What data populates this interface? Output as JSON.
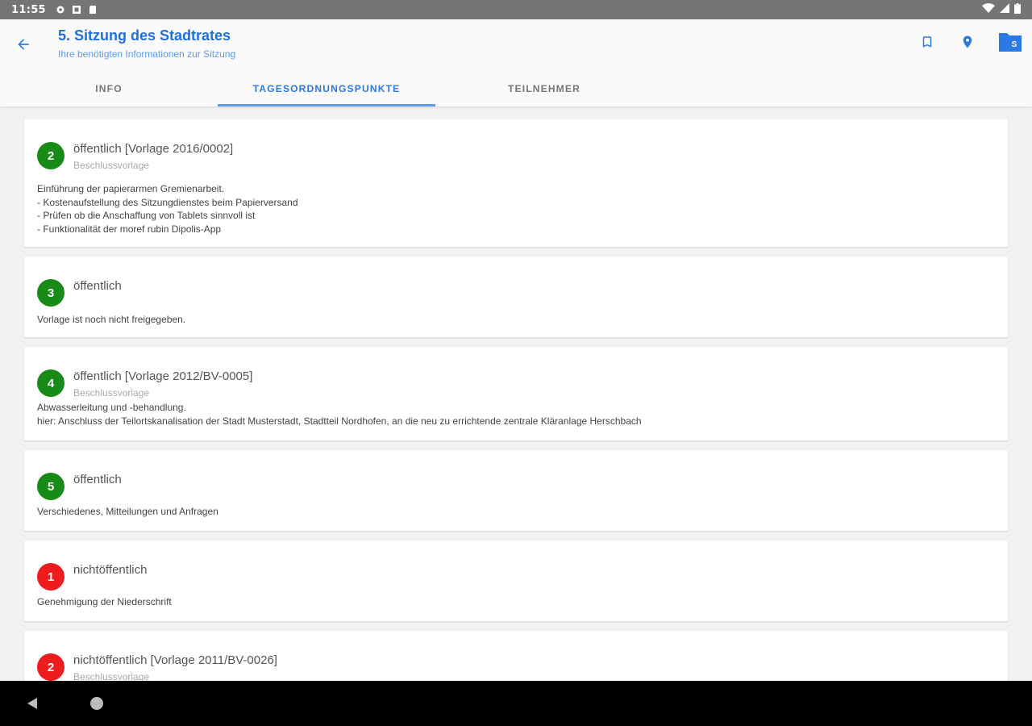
{
  "status_bar": {
    "time": "11:55"
  },
  "app_bar": {
    "title": "5. Sitzung des Stadtrates",
    "subtitle": "Ihre benötigten Informationen zur Sitzung",
    "folder_badge": "S"
  },
  "tabs": [
    {
      "label": "INFO"
    },
    {
      "label": "TAGESORDNUNGSPUNKTE"
    },
    {
      "label": "TEILNEHMER"
    }
  ],
  "agenda": [
    {
      "number": "2",
      "status": "green",
      "title": "öffentlich [Vorlage 2016/0002]",
      "subtitle": "Beschlussvorlage",
      "body": "Einführung der papierarmen Gremienarbeit.\n- Kostenaufstellung des Sitzungdienstes beim Papierversand\n- Prüfen ob die Anschaffung von Tablets sinnvoll ist\n- Funktionalität der moref rubin Dipolis-App"
    },
    {
      "number": "3",
      "status": "green",
      "title": "öffentlich",
      "subtitle": "",
      "body": " Vorlage ist noch nicht freigegeben."
    },
    {
      "number": "4",
      "status": "green",
      "title": "öffentlich [Vorlage 2012/BV-0005]",
      "subtitle": "Beschlussvorlage",
      "body": "Abwasserleitung und -behandlung.\nhier: Anschluss der Teilortskanalisation der Stadt Musterstadt, Stadtteil Nordhofen, an die neu zu errichtende zentrale Kläranlage Herschbach"
    },
    {
      "number": "5",
      "status": "green",
      "title": "öffentlich",
      "subtitle": "",
      "body": "Verschiedenes, Mitteilungen und Anfragen"
    },
    {
      "number": "1",
      "status": "red",
      "title": "nichtöffentlich",
      "subtitle": "",
      "body": "Genehmigung der Niederschrift"
    },
    {
      "number": "2",
      "status": "red",
      "title": "nichtöffentlich [Vorlage 2011/BV-0026]",
      "subtitle": "Beschlussvorlage",
      "body": ""
    }
  ]
}
